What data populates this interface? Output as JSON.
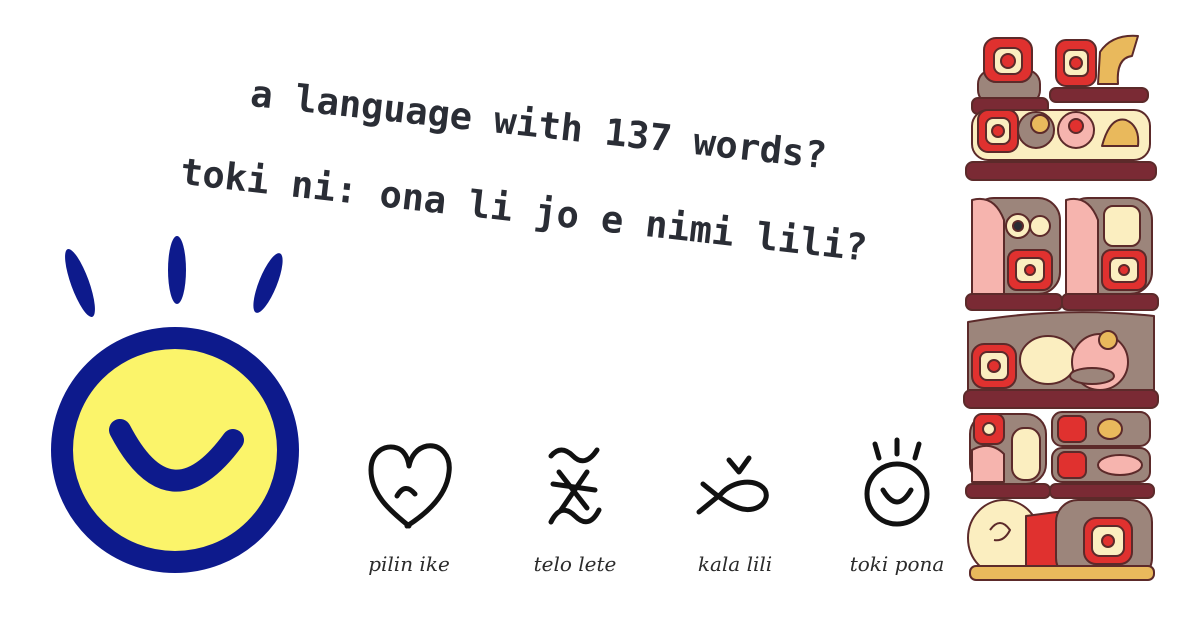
{
  "headline": {
    "line1": "a language with 137 words?",
    "line2": "toki ni: ona li jo e nimi lili?"
  },
  "logo": {
    "icon": "smiling-sun-icon",
    "face_fill": "#fbf46a",
    "outline": "#0d1a8c"
  },
  "glyphs": [
    {
      "label": "pilin ike",
      "icon": "sad-heart-glyph-icon"
    },
    {
      "label": "telo lete",
      "icon": "cold-water-glyph-icon"
    },
    {
      "label": "kala lili",
      "icon": "small-fish-glyph-icon"
    },
    {
      "label": "toki pona",
      "icon": "good-language-glyph-icon"
    }
  ],
  "illustration": {
    "icon": "stacked-block-glyphs-icon",
    "colors": {
      "red": "#e0312f",
      "cream": "#fbeec0",
      "maroon": "#7a2a34",
      "brown": "#9c857b",
      "pink": "#f6b4ae",
      "gold": "#e9b95c"
    }
  }
}
